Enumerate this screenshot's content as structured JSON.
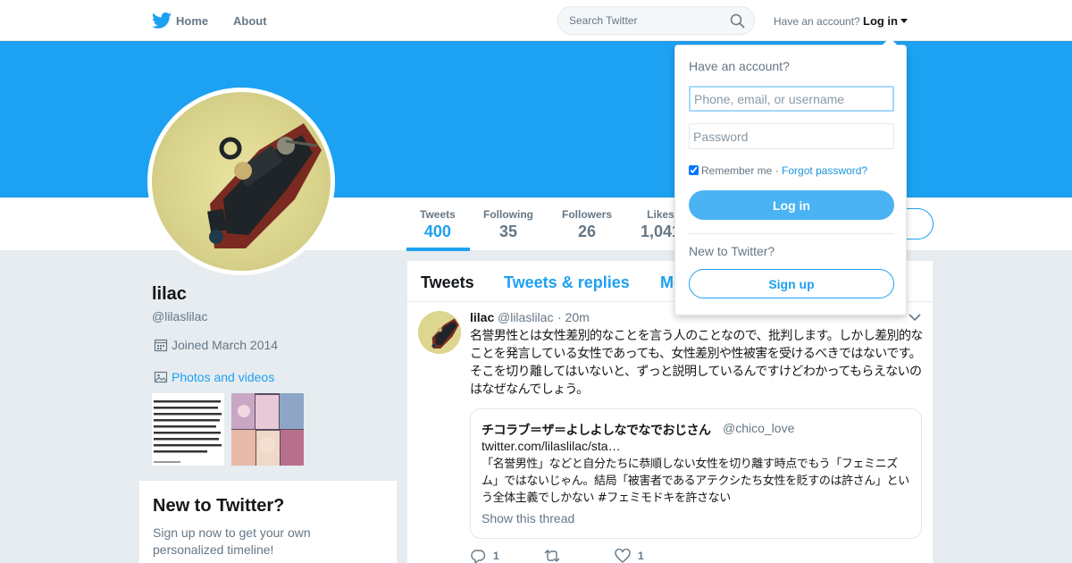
{
  "nav": {
    "home": "Home",
    "about": "About",
    "search_placeholder": "Search Twitter",
    "have_account": "Have an account?",
    "login": "Log in"
  },
  "stats": [
    {
      "label": "Tweets",
      "value": "400"
    },
    {
      "label": "Following",
      "value": "35"
    },
    {
      "label": "Followers",
      "value": "26"
    },
    {
      "label": "Likes",
      "value": "1,041"
    }
  ],
  "profile": {
    "name": "lilac",
    "handle": "@lilaslilac",
    "joined": "Joined March 2014",
    "photos_link": "Photos and videos"
  },
  "new_card": {
    "title": "New to Twitter?",
    "text": "Sign up now to get your own personalized timeline!"
  },
  "tabs": [
    "Tweets",
    "Tweets & replies",
    "Media"
  ],
  "tweet": {
    "name": "lilac",
    "handle": "@lilaslilac",
    "time": "· 20m",
    "text": "名誉男性とは女性差別的なことを言う人のことなので、批判します。しかし差別的なことを発言している女性であっても、女性差別や性被害を受けるべきではないです。そこを切り離してはいないと、ずっと説明しているんですけどわかってもらえないのはなぜなんでしょう。",
    "quote": {
      "name": "チコラブ＝ザ＝よしよしなでなでおじさん",
      "handle": "@chico_love",
      "link": "twitter.com/lilaslilac/sta…",
      "text": "「名誉男性」などと自分たちに恭順しない女性を切り離す時点でもう「フェミニズム」ではないじゃん。結局「被害者であるアテクシたち女性を貶すのは許さん」という全体主義でしかない #フェミモドキを許さない",
      "show_thread": "Show this thread"
    },
    "actions": {
      "replies": "1",
      "retweets": "",
      "likes": "1"
    }
  },
  "dropdown": {
    "title": "Have an account?",
    "username_placeholder": "Phone, email, or username",
    "password_placeholder": "Password",
    "remember": "Remember me",
    "separator": "·",
    "forgot": "Forgot password?",
    "login_button": "Log in",
    "new_to_twitter": "New to Twitter?",
    "signup_button": "Sign up"
  },
  "colors": {
    "accent": "#1da1f2",
    "banner": "#1da1f2"
  }
}
